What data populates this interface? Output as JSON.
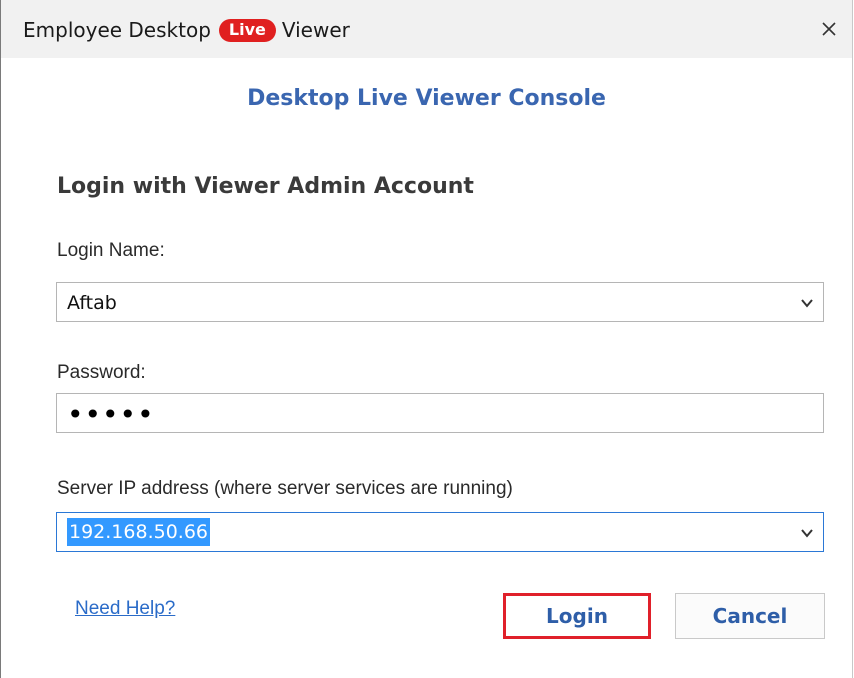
{
  "window": {
    "title_before": "Employee Desktop",
    "title_badge": "Live",
    "title_after": "Viewer",
    "close_glyph": "×"
  },
  "main": {
    "heading": "Desktop Live Viewer Console",
    "subheading": "Login with Viewer Admin Account"
  },
  "form": {
    "login_name": {
      "label": "Login Name:",
      "value": "Aftab"
    },
    "password": {
      "label": "Password:",
      "masked_value": "•••••"
    },
    "server_ip": {
      "label": "Server IP address (where server services are running)",
      "value": "192.168.50.66"
    }
  },
  "footer": {
    "help_link": "Need Help?",
    "login_button": "Login",
    "cancel_button": "Cancel"
  },
  "colors": {
    "badge": "#e02020",
    "heading": "#3a66b0",
    "link": "#2a6bc8",
    "login_highlight": "#e0202a",
    "selection": "#3399ff"
  },
  "icons": {
    "close": "close-icon",
    "dropdown": "chevron-down-icon"
  }
}
